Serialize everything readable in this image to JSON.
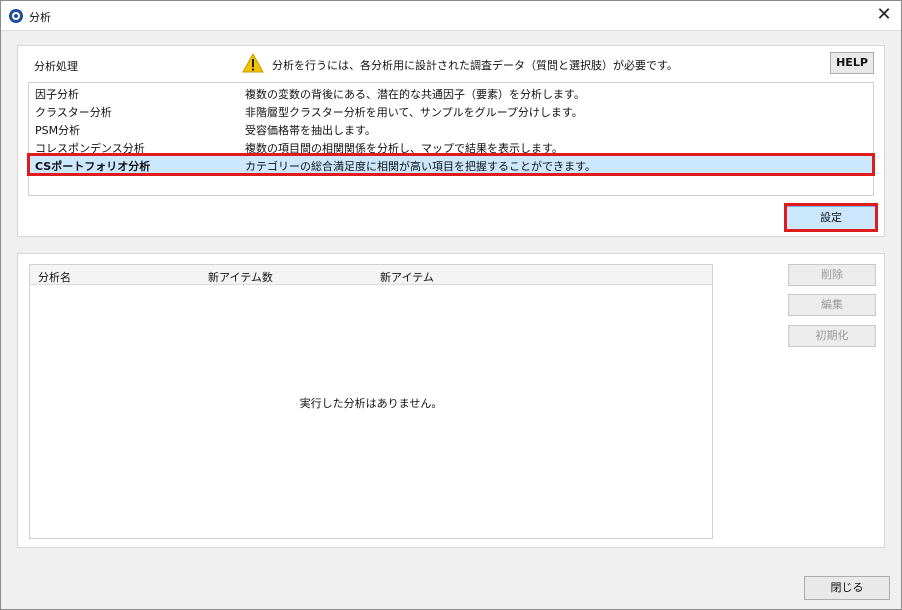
{
  "window": {
    "title": "分析",
    "close_glyph": "✕"
  },
  "analysis_section": {
    "label": "分析処理",
    "warning_text": "分析を行うには、各分析用に設計された調査データ（質問と選択肢）が必要です。",
    "help_label": "HELP",
    "items": [
      {
        "name": "因子分析",
        "description": "複数の変数の背後にある、潜在的な共通因子（要素）を分析します。"
      },
      {
        "name": "クラスター分析",
        "description": "非階層型クラスター分析を用いて、サンプルをグループ分けします。"
      },
      {
        "name": "PSM分析",
        "description": "受容価格帯を抽出します。"
      },
      {
        "name": "コレスポンデンス分析",
        "description": "複数の項目間の相関関係を分析し、マップで結果を表示します。"
      },
      {
        "name": "CSポートフォリオ分析",
        "description": "カテゴリーの総合満足度に相関が高い項目を把握することができます。"
      }
    ],
    "selected_index": 4,
    "setting_label": "設定"
  },
  "results_section": {
    "columns": [
      "分析名",
      "新アイテム数",
      "新アイテム"
    ],
    "empty_message": "実行した分析はありません。",
    "delete_label": "削除",
    "edit_label": "編集",
    "reset_label": "初期化"
  },
  "footer": {
    "close_label": "閉じる"
  },
  "colors": {
    "selection": "#cce8ff",
    "highlight": "#e01b1b",
    "warning": "#f5c400"
  }
}
